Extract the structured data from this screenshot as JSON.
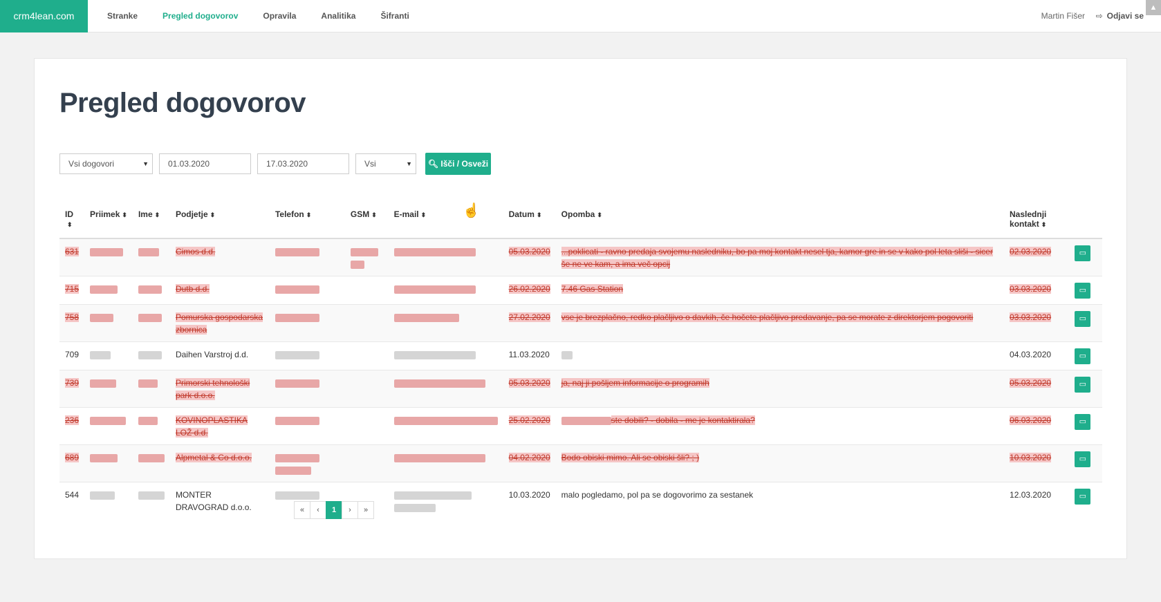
{
  "brand": "crm4lean.com",
  "nav": [
    {
      "label": "Stranke",
      "active": false
    },
    {
      "label": "Pregled dogovorov",
      "active": true
    },
    {
      "label": "Opravila",
      "active": false
    },
    {
      "label": "Analitika",
      "active": false
    },
    {
      "label": "Šifranti",
      "active": false
    }
  ],
  "user": "Martin Fišer",
  "logout": "Odjavi se",
  "page_title": "Pregled dogovorov",
  "filters": {
    "type": "Vsi dogovori",
    "date_from": "01.03.2020",
    "date_to": "17.03.2020",
    "who": "Vsi",
    "search_button": "Išči / Osveži"
  },
  "columns": [
    "ID",
    "Priimek",
    "Ime",
    "Podjetje",
    "Telefon",
    "GSM",
    "E-mail",
    "Datum",
    "Opomba",
    "Naslednji kontakt"
  ],
  "rows": [
    {
      "id": "631",
      "company": "Cimos d.d.",
      "date": "05.03.2020",
      "note": "...poklicati - ravno predaja svojemu nasledniku, bo pa moj kontakt nesel tja, kamor gre in se v kako pol leta sliši - sicer še ne ve kam, a ima več opcij",
      "next": "02.03.2020",
      "done": true
    },
    {
      "id": "715",
      "company": "Dutb d.d.",
      "date": "26.02.2020",
      "note": "7.46 Gas Station",
      "next": "03.03.2020",
      "done": true
    },
    {
      "id": "758",
      "company": "Pomurska gospodarska zbornica",
      "date": "27.02.2020",
      "note": "vse je brezplačno, redko plačljivo o davkih, če hočete plačljivo predavanje, pa se morate z direktorjem pogovoriti",
      "next": "03.03.2020",
      "done": true
    },
    {
      "id": "709",
      "company": "Daihen Varstroj d.d.",
      "date": "11.03.2020",
      "note": "",
      "next": "04.03.2020",
      "done": false
    },
    {
      "id": "739",
      "company": "Primorski tehnološki park d.o.o.",
      "date": "05.03.2020",
      "note": "ja, naj ji pošljem informacije o programih",
      "next": "05.03.2020",
      "done": true
    },
    {
      "id": "236",
      "company": "KOVINOPLASTIKA LOŽ d.d.",
      "date": "25.02.2020",
      "note": "ste dobili? - dobila - me je kontaktirala?",
      "next": "06.03.2020",
      "done": true
    },
    {
      "id": "689",
      "company": "Alpmetal & Co d.o.o.",
      "date": "04.02.2020",
      "note": "Bodo obiski mimo. Ali se obiski šli? ; )",
      "next": "10.03.2020",
      "done": true
    },
    {
      "id": "544",
      "company": "MONTER DRAVOGRAD d.o.o.",
      "date": "10.03.2020",
      "note": "malo pogledamo, pol pa se dogovorimo za sestanek",
      "next": "12.03.2020",
      "done": false
    }
  ],
  "pager": [
    "«",
    "‹",
    "1",
    "›",
    "»"
  ]
}
